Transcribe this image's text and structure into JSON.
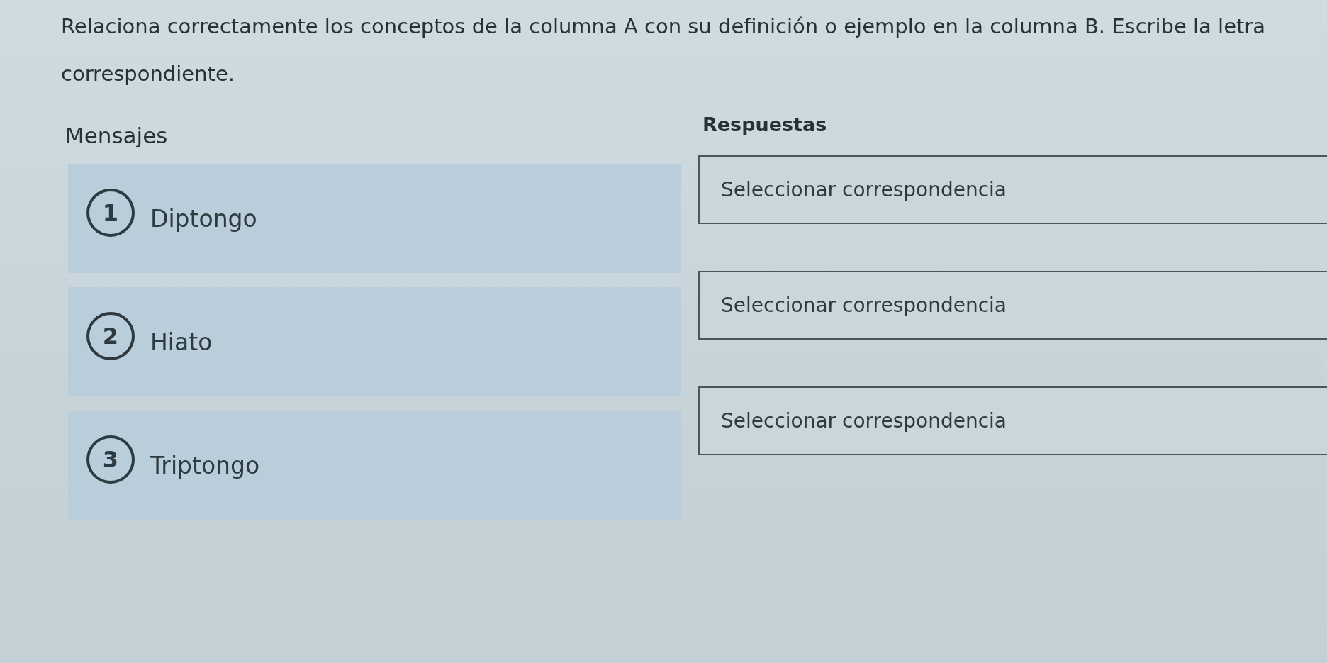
{
  "instructions": "Relaciona correctamente los conceptos de la columna A con su definición o ejemplo en la columna B. Escribe la letra correspondiente.",
  "headings": {
    "left": "Mensajes",
    "right": "Respuestas"
  },
  "pairs": [
    {
      "number": "1",
      "concept": "Diptongo",
      "answer": {
        "placeholder": "Seleccionar correspondencia"
      }
    },
    {
      "number": "2",
      "concept": "Hiato",
      "answer": {
        "placeholder": "Seleccionar correspondencia"
      }
    },
    {
      "number": "3",
      "concept": "Triptongo",
      "answer": {
        "placeholder": "Seleccionar correspondencia"
      }
    }
  ]
}
